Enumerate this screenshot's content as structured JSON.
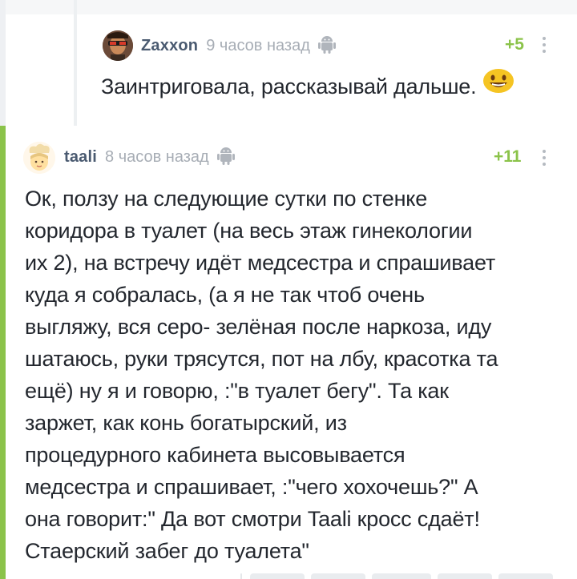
{
  "comments": [
    {
      "author": "Zaxxon",
      "time": "9 часов назад",
      "rating": "+5",
      "text": "Заинтриговала, рассказывай дальше.",
      "emoji": "smiling-face"
    },
    {
      "author": "taali",
      "time": "8 часов назад",
      "rating": "+11",
      "lines": [
        "Ок, ползу на следующие сутки по стенке",
        "коридора в туалет (на весь этаж гинекологии",
        "их 2), на встречу идёт медсестра и спрашивает",
        "куда я собралась, (а я не так чтоб очень",
        "выгляжу, вся серо- зелёная после наркоза, иду",
        "шатаюсь, руки трясутся, пот на лбу, красотка та",
        "ещё) ну я и говорю, :\"в туалет бегу\". Та как",
        "заржет, как конь богатырский, из",
        "процедурного кабинета высовывается",
        "медсестра и спрашивает, :\"чего хохочешь?\" А",
        "она говорит:\" Да вот смотри Taali кросс сдаёт!",
        "Стаерский забег до туалета\""
      ]
    }
  ],
  "colors": {
    "accent_green": "#8bc34a",
    "nick": "#4a5a70",
    "muted": "#a7adb5",
    "text": "#23272e"
  }
}
